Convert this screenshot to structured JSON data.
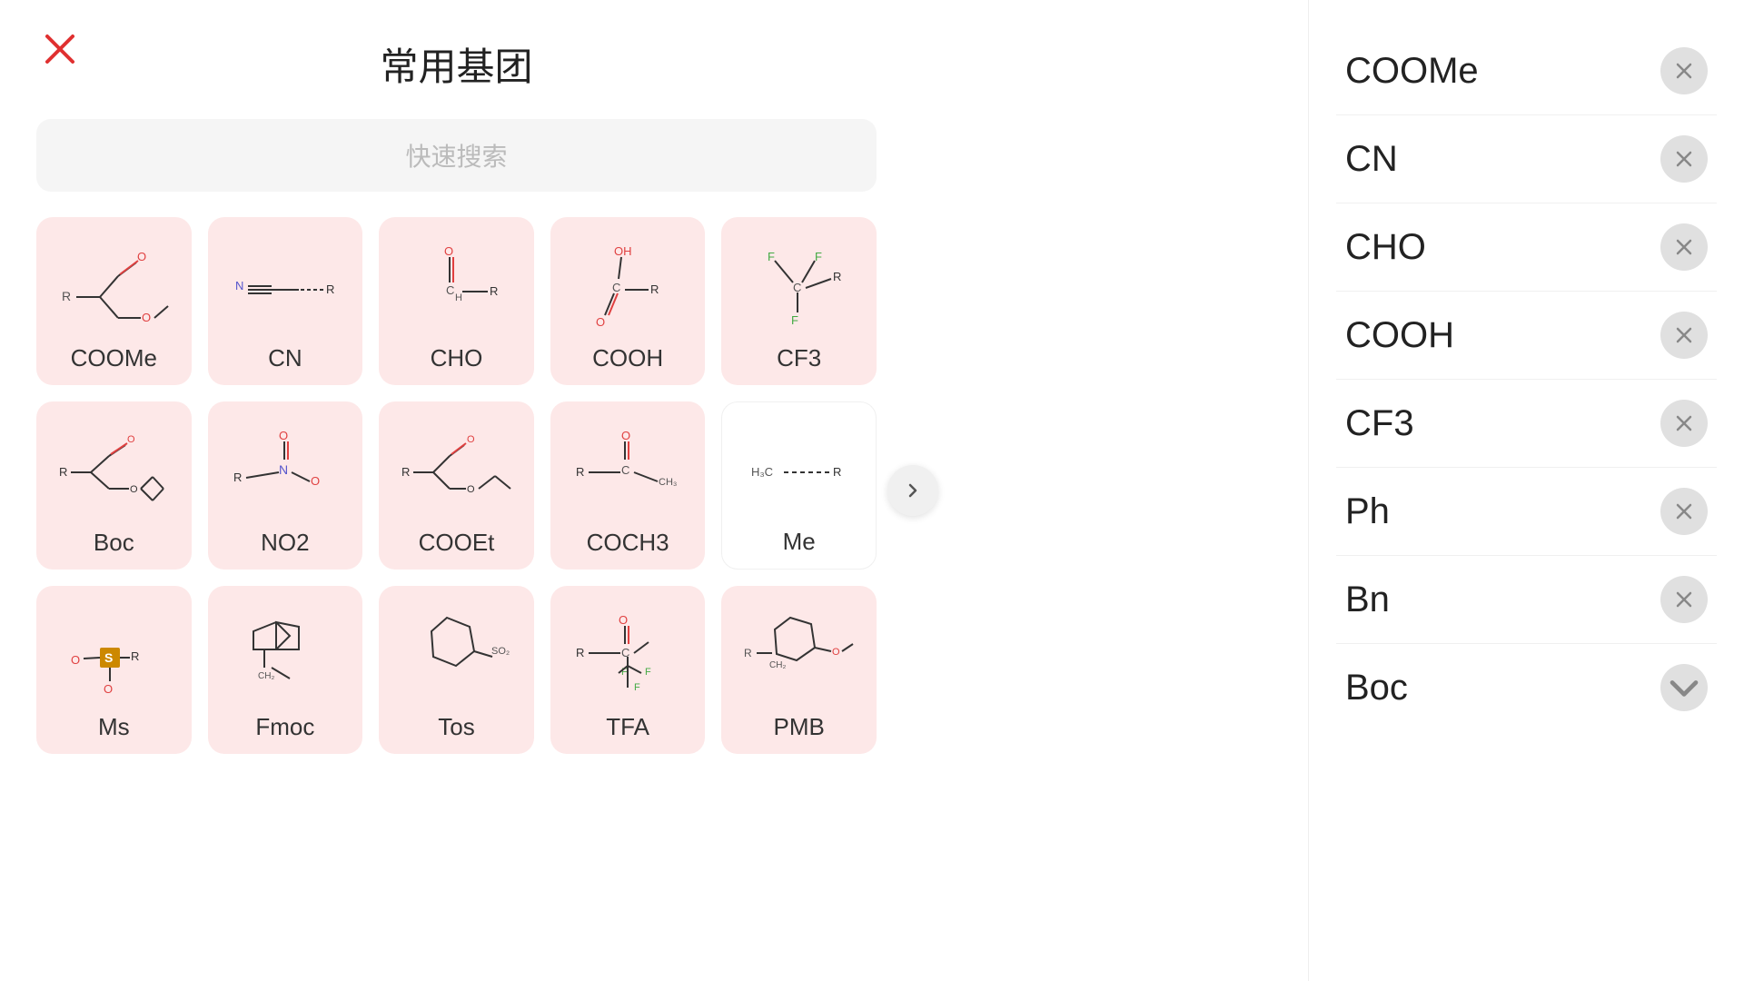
{
  "page": {
    "title": "常用基团",
    "close_label": "close"
  },
  "search": {
    "placeholder": "快速搜索"
  },
  "grid_items": [
    {
      "id": "COOMe",
      "label": "COOMe",
      "white": false
    },
    {
      "id": "CN",
      "label": "CN",
      "white": false
    },
    {
      "id": "CHO",
      "label": "CHO",
      "white": false
    },
    {
      "id": "COOH",
      "label": "COOH",
      "white": false
    },
    {
      "id": "CF3",
      "label": "CF3",
      "white": false
    },
    {
      "id": "Boc",
      "label": "Boc",
      "white": false
    },
    {
      "id": "NO2",
      "label": "NO2",
      "white": false
    },
    {
      "id": "COOEt",
      "label": "COOEt",
      "white": false
    },
    {
      "id": "COCH3",
      "label": "COCH3",
      "white": false
    },
    {
      "id": "Me",
      "label": "Me",
      "white": true
    },
    {
      "id": "Ms",
      "label": "Ms",
      "white": false
    },
    {
      "id": "Fmoc",
      "label": "Fmoc",
      "white": false
    },
    {
      "id": "Tos",
      "label": "Tos",
      "white": false
    },
    {
      "id": "TFA",
      "label": "TFA",
      "white": false
    },
    {
      "id": "PMB",
      "label": "PMB",
      "white": false
    }
  ],
  "right_panel": {
    "items": [
      {
        "label": "COOMe"
      },
      {
        "label": "CN"
      },
      {
        "label": "CHO"
      },
      {
        "label": "COOH"
      },
      {
        "label": "CF3"
      },
      {
        "label": "Ph"
      },
      {
        "label": "Bn"
      },
      {
        "label": "Boc",
        "partial": true
      }
    ]
  },
  "colors": {
    "pink_bg": "#fde8e8",
    "accent_red": "#e03030",
    "gray_remove": "#d0d0d0"
  }
}
